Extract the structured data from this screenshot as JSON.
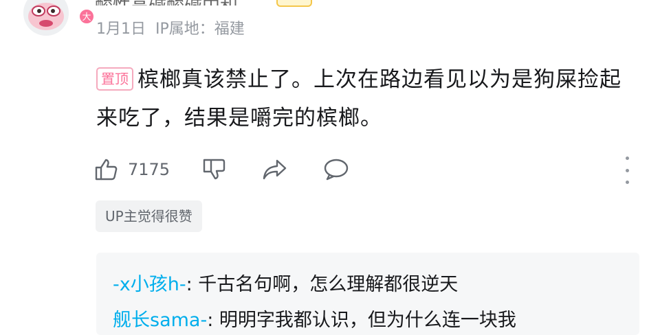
{
  "user": {
    "name": "酸性高碱酸碱中和",
    "badge": "大",
    "date": "1月1日",
    "ip_location": "IP属地：福建"
  },
  "comment": {
    "pin_label": "置顶",
    "text": "槟榔真该禁止了。上次在路边看见以为是狗屎捡起来吃了，结果是嚼完的槟榔。"
  },
  "actions": {
    "like_count": "7175"
  },
  "up_tag": "UP主觉得很赞",
  "replies": [
    {
      "name": "-x小孩h-",
      "sep": ": ",
      "text": "千古名句啊，怎么理解都很逆天"
    },
    {
      "name": "舰长sama-",
      "sep": ": ",
      "text": "明明字我都认识，但为什么连一块我"
    }
  ],
  "colors": {
    "accent_pink": "#fb7299",
    "link_blue": "#00aeec",
    "icon_gray": "#61666d"
  }
}
